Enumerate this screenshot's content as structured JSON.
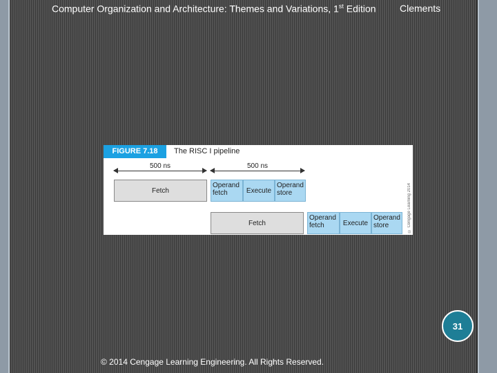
{
  "header": {
    "title_main": "Computer Organization and Architecture: Themes and Variations, 1",
    "title_sup": "st",
    "title_end": " Edition",
    "author": "Clements"
  },
  "figure": {
    "tag": "FIGURE 7.18",
    "title": "The RISC I pipeline",
    "dim1": "500 ns",
    "dim2": "500 ns",
    "row1": {
      "fetch": "Fetch",
      "operand_fetch": "Operand fetch",
      "execute": "Execute",
      "operand_store": "Operand store"
    },
    "row2": {
      "fetch": "Fetch",
      "operand_fetch": "Operand fetch",
      "execute": "Execute",
      "operand_store": "Operand store"
    },
    "credit": "© Cengage Learning 2014"
  },
  "slide": {
    "page_number": "31",
    "footer": "© 2014 Cengage Learning Engineering. All Rights Reserved."
  },
  "colors": {
    "figure_tag": "#1ba1e2",
    "stage_blue": "#aad8f2",
    "stage_gray": "#dedede",
    "badge": "#1e7e96"
  }
}
